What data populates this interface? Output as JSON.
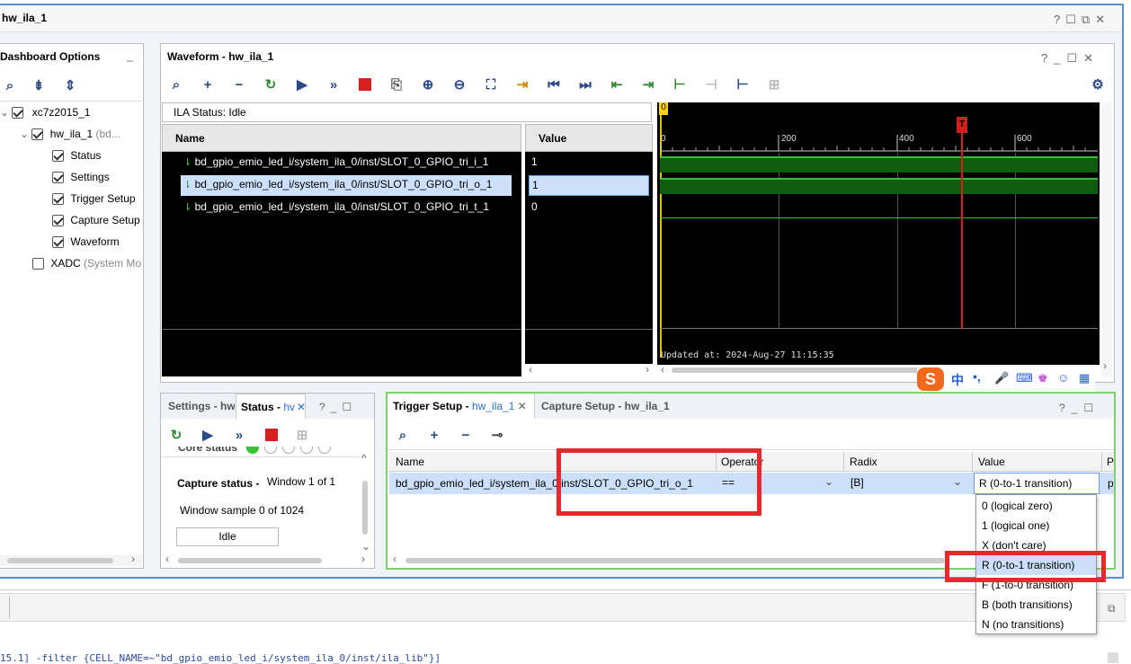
{
  "window": {
    "title": "hw_ila_1"
  },
  "dashboard": {
    "title": "Dashboard Options",
    "device": "xc7z2015_1",
    "ila": "hw_ila_1",
    "ila_suffix": "(bd...",
    "items": [
      "Status",
      "Settings",
      "Trigger Setup",
      "Capture Setup",
      "Waveform"
    ],
    "xadc": "XADC",
    "xadc_suffix": "(System Mon"
  },
  "waveform": {
    "title": "Waveform - hw_ila_1",
    "ila_status": "ILA Status: Idle",
    "col_name": "Name",
    "col_value": "Value",
    "signals": [
      {
        "name": "bd_gpio_emio_led_i/system_ila_0/inst/SLOT_0_GPIO_tri_i_1",
        "value": "1"
      },
      {
        "name": "bd_gpio_emio_led_i/system_ila_0/inst/SLOT_0_GPIO_tri_o_1",
        "value": "1"
      },
      {
        "name": "bd_gpio_emio_led_i/system_ila_0/inst/SLOT_0_GPIO_tri_t_1",
        "value": "0"
      }
    ],
    "cursor_left": "0",
    "trigger_marker": "T",
    "ticks": [
      "0",
      "200",
      "400",
      "600"
    ],
    "updated": "Updated at: 2024-Aug-27 11:15:35"
  },
  "status_panel": {
    "tab_settings": "Settings - hw",
    "tab_status": "Status - ",
    "tab_status_blue": "hv",
    "core_status": "Core status",
    "capture_label": "Capture status -",
    "capture_value": "Window 1 of 1",
    "window_sample": "Window sample 0 of 1024",
    "idle": "Idle"
  },
  "trigger": {
    "tab1": "Trigger Setup - ",
    "tab1_blue": "hw_ila_1",
    "tab2": "Capture Setup - hw_ila_1",
    "col_name": "Name",
    "col_operator": "Operator",
    "col_radix": "Radix",
    "col_value": "Value",
    "col_p": "P",
    "row_name": "bd_gpio_emio_led_i/system_ila_0/inst/SLOT_0_GPIO_tri_o_1",
    "row_operator": "==",
    "row_radix": "[B]",
    "row_value": "R (0-to-1 transition)",
    "row_p": "p",
    "options": [
      "0 (logical zero)",
      "1 (logical one)",
      "X (don't care)",
      "R (0-to-1 transition)",
      "F (1-to-0 transition)",
      "B (both transitions)",
      "N (no transitions)"
    ]
  },
  "console": {
    "line": "15.1] -filter {CELL_NAME=~\"bd_gpio_emio_led_i/system_ila_0/inst/ila_lib\"}]"
  },
  "ime": {
    "chars": [
      "中",
      "•,"
    ]
  },
  "colors": {
    "highlight_red": "#e8282b",
    "green_border": "#7fd36f",
    "wave_green": "#1a6e1a",
    "trigger_red": "#d41f1f",
    "sel_row": "#cce0fb"
  }
}
